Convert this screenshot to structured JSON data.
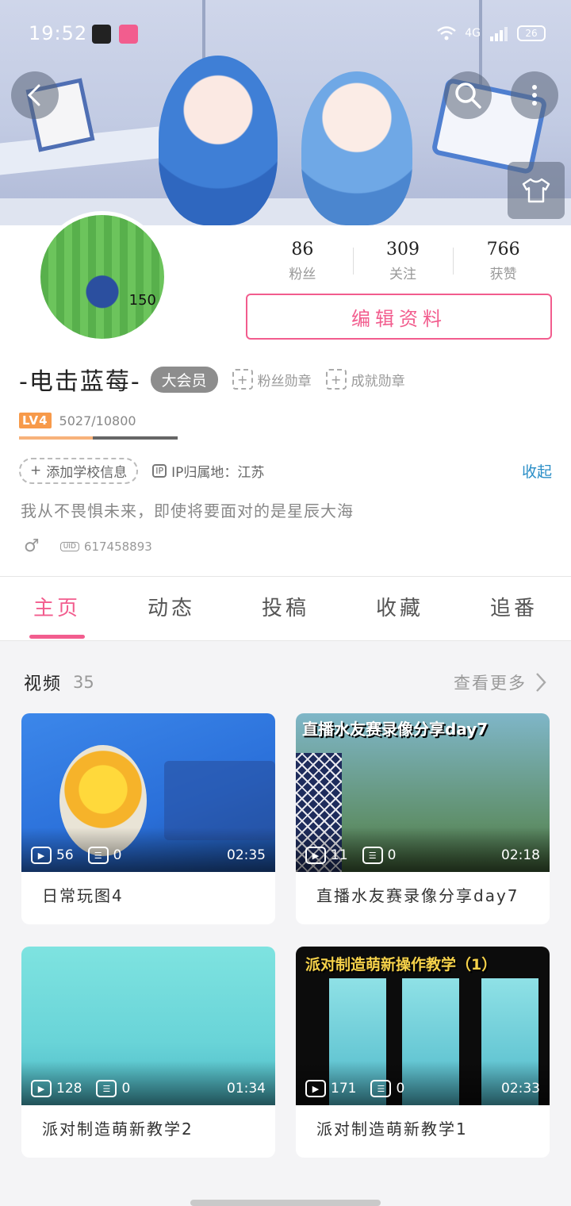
{
  "status_bar": {
    "time": "19:52",
    "network": "4G",
    "battery": "26"
  },
  "profile": {
    "username": "-电击蓝莓-",
    "vip_badge": "大会员",
    "avatar_label": "150",
    "fans_medal": "粉丝勋章",
    "achievement_medal": "成就勋章",
    "level": "LV4",
    "exp": "5027/10800",
    "exp_progress": 0.465,
    "school_button": "添加学校信息",
    "ip_location": "IP归属地：江苏",
    "collapse_label": "收起",
    "bio": "我从不畏惧未来，即使将要面对的是星辰大海",
    "gender_icon": "♂",
    "uid_label": "UID",
    "uid": "617458893",
    "edit_button": "编辑资料"
  },
  "stats": [
    {
      "value": "86",
      "label": "粉丝"
    },
    {
      "value": "309",
      "label": "关注"
    },
    {
      "value": "766",
      "label": "获赞"
    }
  ],
  "tabs": [
    {
      "label": "主页",
      "active": true
    },
    {
      "label": "动态",
      "active": false
    },
    {
      "label": "投稿",
      "active": false
    },
    {
      "label": "收藏",
      "active": false
    },
    {
      "label": "追番",
      "active": false
    }
  ],
  "videos_section": {
    "title": "视频",
    "count": "35",
    "see_more": "查看更多",
    "items": [
      {
        "title": "日常玩图4",
        "plays": "56",
        "danmaku": "0",
        "duration": "02:35",
        "thumb_text": ""
      },
      {
        "title": "直播水友赛录像分享day7",
        "plays": "11",
        "danmaku": "0",
        "duration": "02:18",
        "thumb_text": "直播水友赛录像分享day7"
      },
      {
        "title": "派对制造萌新教学2",
        "plays": "128",
        "danmaku": "0",
        "duration": "01:34",
        "thumb_text": ""
      },
      {
        "title": "派对制造萌新教学1",
        "plays": "171",
        "danmaku": "0",
        "duration": "02:33",
        "thumb_text": "派对制造萌新操作教学（1）"
      }
    ]
  },
  "colors": {
    "accent": "#f25d8e",
    "link": "#2a8ec7",
    "level": "#f79a4a"
  },
  "icons": [
    "back-icon",
    "search-icon",
    "more-icon",
    "dress-up-icon",
    "play-icon",
    "danmaku-icon",
    "chevron-right-icon"
  ]
}
